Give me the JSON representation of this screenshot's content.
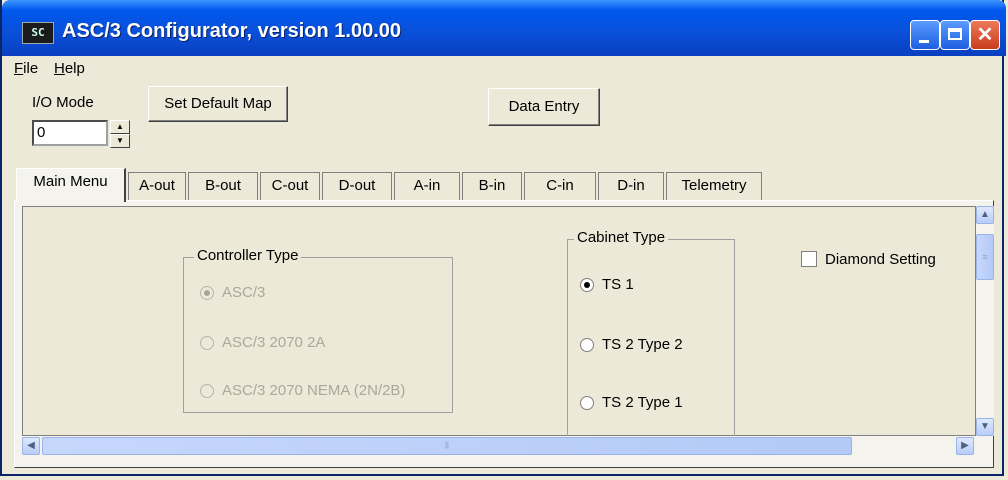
{
  "window": {
    "title": "ASC/3 Configurator, version 1.00.00",
    "icon": "app-icon",
    "icon_text": "SC",
    "controls": [
      "minimize-icon",
      "maximize-icon",
      "close-icon"
    ]
  },
  "menu": {
    "file": {
      "mnemonic": "F",
      "rest": "ile"
    },
    "help": {
      "mnemonic": "H",
      "rest": "elp"
    }
  },
  "toolbar": {
    "io_mode_label": "I/O Mode",
    "io_mode_value": "0",
    "set_default_map": "Set Default Map",
    "data_entry": "Data Entry"
  },
  "tabs": [
    {
      "label": "Main Menu",
      "active": true
    },
    {
      "label": "A-out"
    },
    {
      "label": "B-out"
    },
    {
      "label": "C-out"
    },
    {
      "label": "D-out"
    },
    {
      "label": "A-in"
    },
    {
      "label": "B-in"
    },
    {
      "label": "C-in"
    },
    {
      "label": "D-in"
    },
    {
      "label": "Telemetry"
    }
  ],
  "controller_type": {
    "title": "Controller Type",
    "options": [
      {
        "label": "ASC/3",
        "selected": true,
        "enabled": false
      },
      {
        "label": "ASC/3 2070 2A",
        "selected": false,
        "enabled": false
      },
      {
        "label": "ASC/3 2070 NEMA (2N/2B)",
        "selected": false,
        "enabled": false
      }
    ]
  },
  "cabinet_type": {
    "title": "Cabinet Type",
    "options": [
      {
        "label": "TS 1",
        "selected": true
      },
      {
        "label": "TS 2 Type 2",
        "selected": false
      },
      {
        "label": "TS 2 Type 1",
        "selected": false
      }
    ]
  },
  "diamond_setting": {
    "label": "Diamond Setting",
    "checked": false
  },
  "colors": {
    "titlebar": "#0058ee",
    "face": "#ece9d8",
    "disabled_text": "#aca899"
  }
}
